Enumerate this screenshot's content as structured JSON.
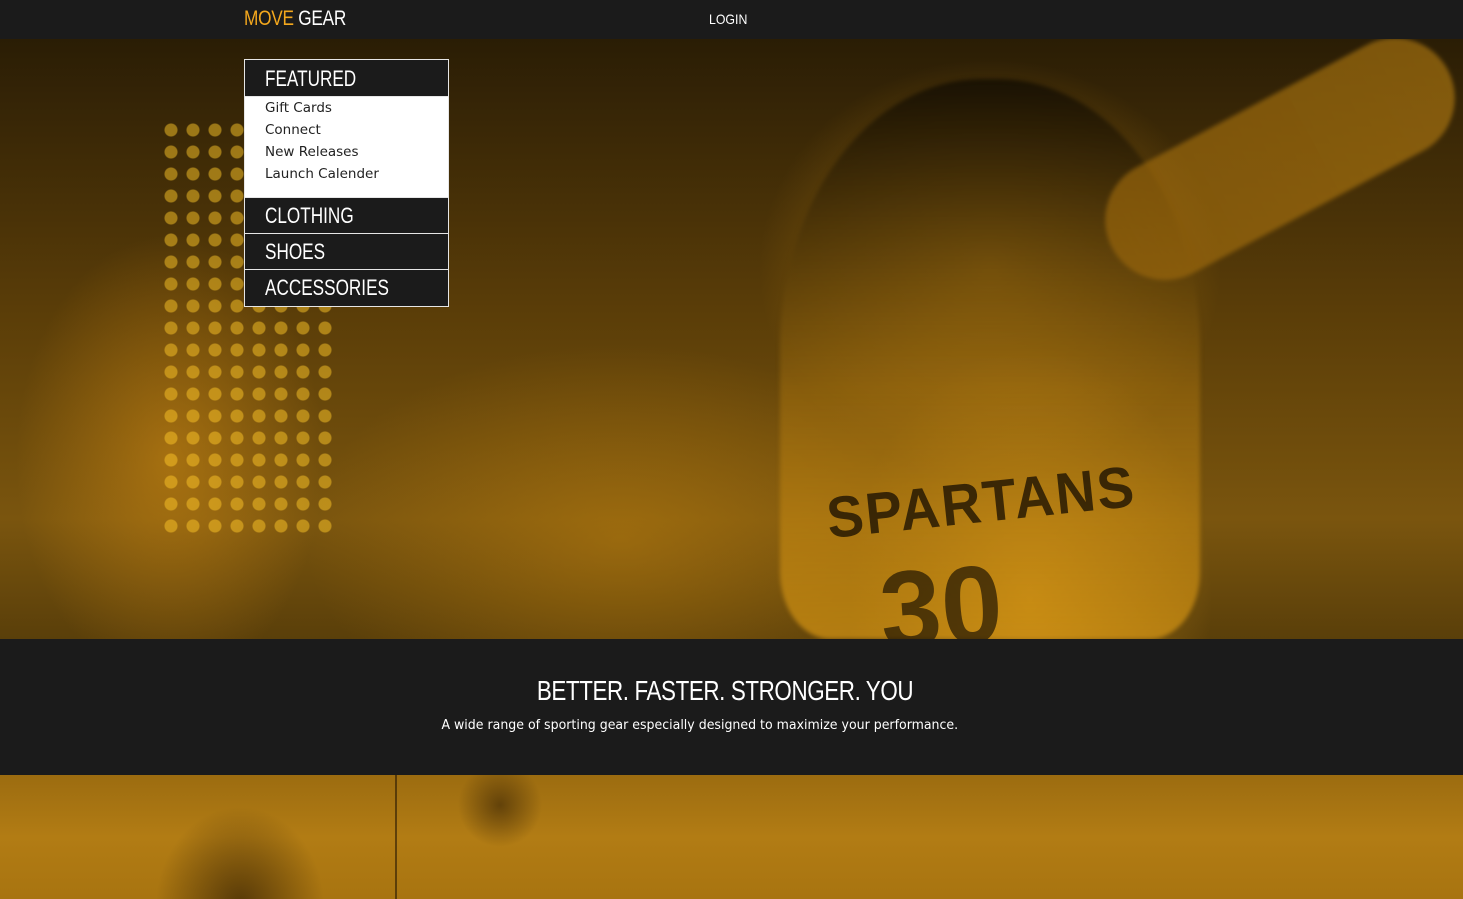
{
  "navbar": {
    "logo_primary": "MOVE",
    "logo_secondary": "GEAR",
    "login_label": "LOGIN"
  },
  "hero": {
    "jersey_text": "SPARTANS",
    "jersey_number": "30"
  },
  "menu": {
    "featured_label": "FEATURED",
    "featured_items": [
      {
        "label": "Gift Cards"
      },
      {
        "label": "Connect"
      },
      {
        "label": "New Releases"
      },
      {
        "label": "Launch Calender"
      }
    ],
    "categories": [
      {
        "label": "CLOTHING"
      },
      {
        "label": "SHOES"
      },
      {
        "label": "ACCESSORIES"
      }
    ]
  },
  "tagline": {
    "heading": "BETTER. FASTER. STRONGER. YOU",
    "subtext": "A wide range of sporting gear especially designed to maximize your performance."
  },
  "colors": {
    "accent": "#f4a81d",
    "dark": "#1b1b1b",
    "light": "#ffffff"
  }
}
